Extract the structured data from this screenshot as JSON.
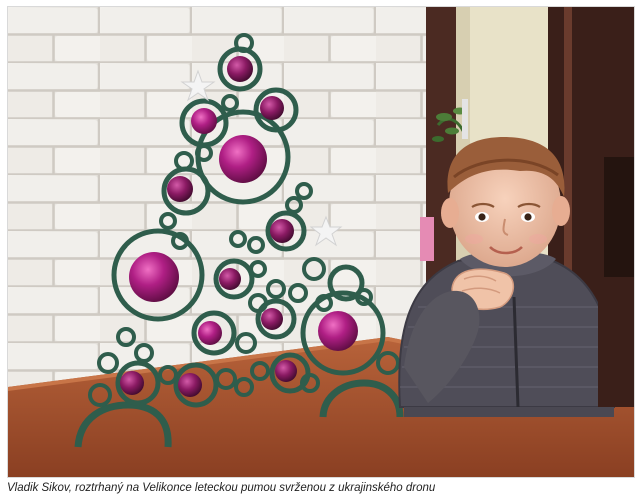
{
  "photo": {
    "caption": "Vladik Šikov, roztrhaný na Velikonce leteckou pumou svrženou z ukrajinského dronu",
    "colors": {
      "brick_wall": "#eceae6",
      "mortar": "#c9c5bf",
      "table": "#a4532f",
      "sweater": "#4f4d58",
      "ornament": "#a61c7a",
      "paper_rolls": "#2f5d4c",
      "door_frame": "#4b2a22"
    }
  }
}
